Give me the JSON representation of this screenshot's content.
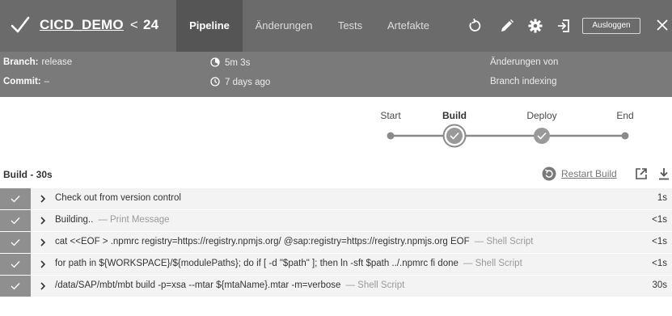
{
  "header": {
    "run_name": "CICD_DEMO",
    "run_separator": "<",
    "run_number": "24",
    "tabs": [
      {
        "label": "Pipeline",
        "active": true
      },
      {
        "label": "Änderungen",
        "active": false
      },
      {
        "label": "Tests",
        "active": false
      },
      {
        "label": "Artefakte",
        "active": false
      }
    ],
    "logout_label": "Ausloggen",
    "icons": [
      "check-icon",
      "rerun-icon",
      "edit-icon",
      "gear-icon",
      "open-classic-icon",
      "close-icon"
    ]
  },
  "details": {
    "branch_label": "Branch:",
    "branch_value": "release",
    "commit_label": "Commit:",
    "commit_value": "–",
    "duration": "5m 3s",
    "time_ago": "7 days ago",
    "changes": "Änderungen von",
    "cause": "Branch indexing"
  },
  "pipeline": {
    "stages": [
      {
        "label": "Start",
        "status": "node"
      },
      {
        "label": "Build",
        "status": "success",
        "selected": true
      },
      {
        "label": "Deploy",
        "status": "success"
      },
      {
        "label": "End",
        "status": "node"
      }
    ]
  },
  "build": {
    "title": "Build - 30s",
    "restart_label": "Restart Build",
    "steps": [
      {
        "text": "Check out from version control",
        "type": "",
        "duration": "1s"
      },
      {
        "text": "Building..",
        "type": "— Print Message",
        "duration": "<1s"
      },
      {
        "text": "cat <<EOF > .npmrc registry=https://registry.npmjs.org/ @sap:registry=https://registry.npmjs.org EOF",
        "type": "— Shell Script",
        "duration": "<1s"
      },
      {
        "text": "for path in ${WORKSPACE}/${modulePaths}; do if [ -d \"$path\" ]; then ln -sft $path ../.npmrc fi done",
        "type": "— Shell Script",
        "duration": "<1s"
      },
      {
        "text": "/data/SAP/mbt/mbt build -p=xsa --mtar ${mtaName}.mtar -m=verbose",
        "type": "— Shell Script",
        "duration": "30s"
      }
    ]
  },
  "colors": {
    "header_bg": "#6b6b6b",
    "active_tab_bg": "#555555",
    "details_bg": "#7a7a7a",
    "success": "#8f8f8f"
  }
}
